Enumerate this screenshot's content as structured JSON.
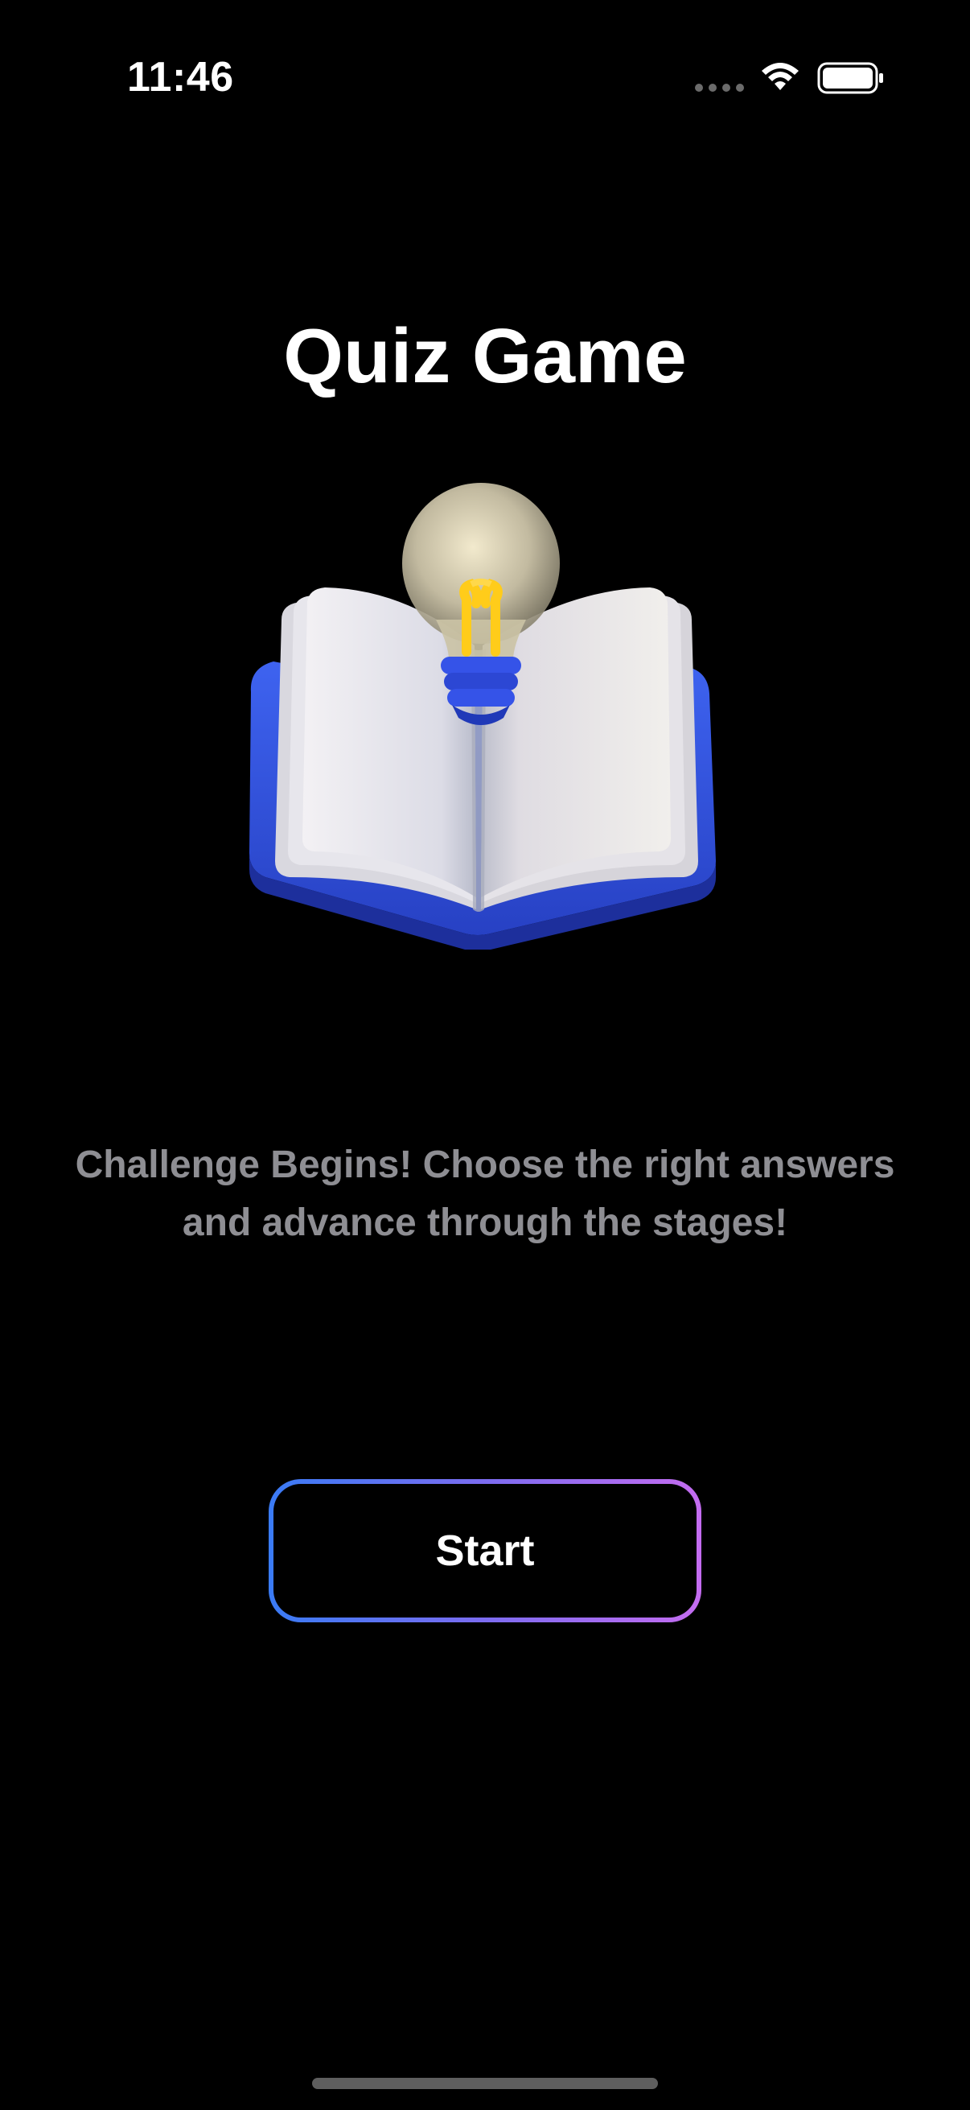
{
  "status_bar": {
    "time": "11:46",
    "icons": [
      "signal-dots-icon",
      "wifi-icon",
      "battery-icon"
    ]
  },
  "screen": {
    "title": "Quiz Game",
    "illustration": "book-lightbulb-illustration",
    "subtitle": "Challenge Begins! Choose the right answers and advance through the stages!",
    "start_button_label": "Start"
  },
  "colors": {
    "background": "#000000",
    "title_text": "#ffffff",
    "subtitle_text": "#8e8e93",
    "button_gradient_start": "#3a7bf5",
    "button_gradient_end": "#c46cf0",
    "book_cover": "#2f4fd6",
    "bulb_glow": "#ffcc1a"
  }
}
